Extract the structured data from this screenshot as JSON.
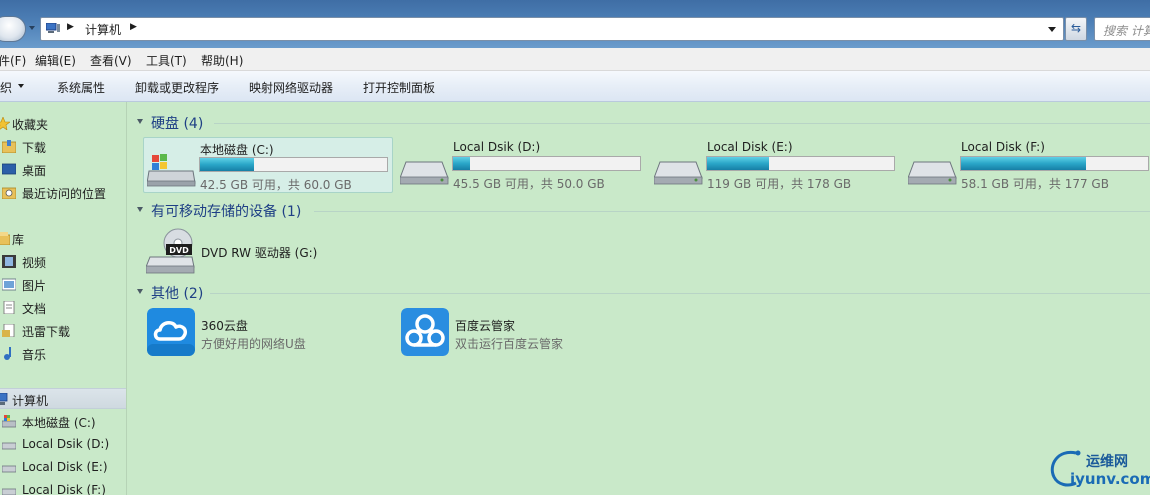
{
  "address_bar": {
    "path": [
      "计算机"
    ],
    "search_placeholder": "搜索 计算机"
  },
  "menu": {
    "items": [
      "件(F)",
      "编辑(E)",
      "查看(V)",
      "工具(T)",
      "帮助(H)"
    ]
  },
  "command_bar": {
    "items": [
      "织",
      "系统属性",
      "卸载或更改程序",
      "映射网络驱动器",
      "打开控制面板"
    ]
  },
  "nav": {
    "favorites_header": "收藏夹",
    "favorites": [
      "下载",
      "桌面",
      "最近访问的位置"
    ],
    "libraries_header": "库",
    "libraries": [
      "视频",
      "图片",
      "文档",
      "迅雷下载",
      "音乐"
    ],
    "computer_header": "计算机",
    "drives": [
      "本地磁盘 (C:)",
      "Local Dsik (D:)",
      "Local Disk (E:)",
      "Local Disk (F:)"
    ]
  },
  "content": {
    "hard_disks_title": "硬盘 (4)",
    "drives": [
      {
        "name": "本地磁盘 (C:)",
        "space": "42.5 GB 可用，共 60.0 GB",
        "used_fraction": 0.29
      },
      {
        "name": "Local Dsik (D:)",
        "space": "45.5 GB 可用，共 50.0 GB",
        "used_fraction": 0.09
      },
      {
        "name": "Local Disk (E:)",
        "space": "119 GB 可用，共 178 GB",
        "used_fraction": 0.33
      },
      {
        "name": "Local Disk (F:)",
        "space": "58.1 GB 可用，共 177 GB",
        "used_fraction": 0.67
      }
    ],
    "removable_title": "有可移动存储的设备 (1)",
    "dvd": {
      "name": "DVD RW 驱动器 (G:)",
      "icon_text": "DVD"
    },
    "other_title": "其他 (2)",
    "other_items": [
      {
        "name": "360云盘",
        "desc": "方便好用的网络U盘",
        "icon": "cloud-360-icon"
      },
      {
        "name": "百度云管家",
        "desc": "双击运行百度云管家",
        "icon": "baidu-cloud-icon"
      }
    ]
  },
  "watermark": {
    "line1": "运维网",
    "line2": "iyunv.com"
  },
  "colors": {
    "background": "#c9e9c9",
    "group_title": "#1e3f85",
    "progress": "#2aa6c8"
  }
}
